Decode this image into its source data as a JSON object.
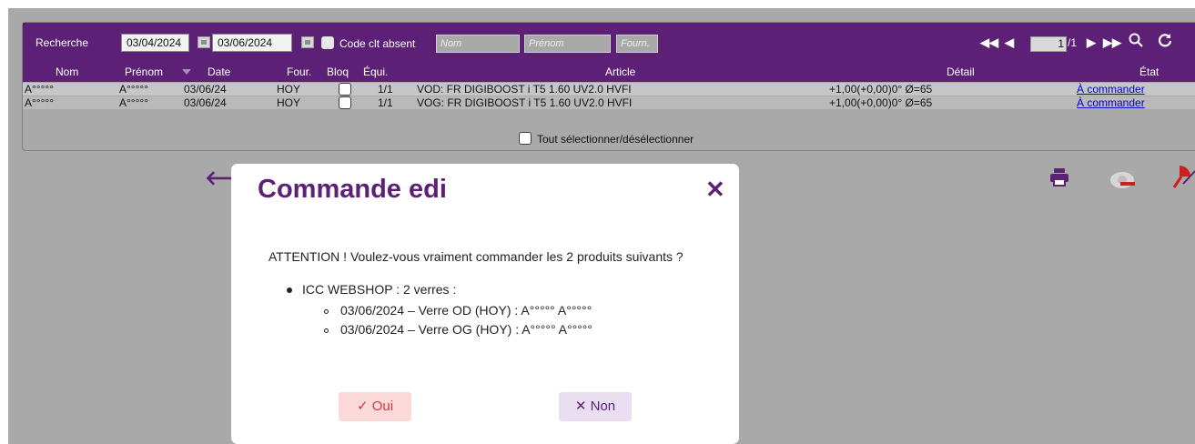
{
  "colors": {
    "purple": "#5c2176",
    "background": "#a9a9a9",
    "oui_text": "#d0393f",
    "oui_bg": "#fcd9d9",
    "non_bg": "#e8def0",
    "link": "#0000cc"
  },
  "toolbar": {
    "search_label": "Recherche",
    "date_from": "03/04/2024",
    "date_to": "03/06/2024",
    "code_clt_absent_label": "Code clt absent",
    "nom_placeholder": "Nom",
    "prenom_placeholder": "Prénom",
    "fourn_placeholder": "Fourn.",
    "page_value": "1",
    "page_total": "/1",
    "icons": [
      "first-page-icon",
      "previous-page-icon",
      "next-page-icon",
      "last-page-icon",
      "search-icon",
      "refresh-icon"
    ]
  },
  "table": {
    "columns": [
      "Nom",
      "Prénom",
      "Date",
      "Four.",
      "Bloq",
      "Équi.",
      "Article",
      "Détail",
      "État"
    ],
    "rows": [
      {
        "nom": "A°°°°°",
        "prenom": "A°°°°°",
        "date": "03/06/24",
        "four": "HOY",
        "equi": "1/1",
        "article": "VOD: FR DIGIBOOST i T5 1.60 UV2.0 HVFI",
        "detail": "+1,00(+0,00)0° Ø=65",
        "etat": "À commander"
      },
      {
        "nom": "A°°°°°",
        "prenom": "A°°°°°",
        "date": "03/06/24",
        "four": "HOY",
        "equi": "1/1",
        "article": "VOG: FR DIGIBOOST i T5 1.60 UV2.0 HVFI",
        "detail": "+1,00(+0,00)0° Ø=65",
        "etat": "À commander"
      }
    ],
    "select_all_label": "Tout sélectionner/désélectionner"
  },
  "actions": {
    "icons": [
      "back-arrow-icon",
      "print-icon",
      "eye-icon",
      "red-tool-icon"
    ]
  },
  "dialog": {
    "title": "Commande edi",
    "message": "ATTENTION ! Voulez-vous vraiment commander les 2 produits suivants ?",
    "group": "ICC WEBSHOP : 2 verres :",
    "items": [
      "03/06/2024 – Verre OD (HOY) : A°°°°° A°°°°°",
      "03/06/2024 – Verre OG (HOY) : A°°°°° A°°°°°"
    ],
    "oui_label": "Oui",
    "non_label": "Non"
  }
}
